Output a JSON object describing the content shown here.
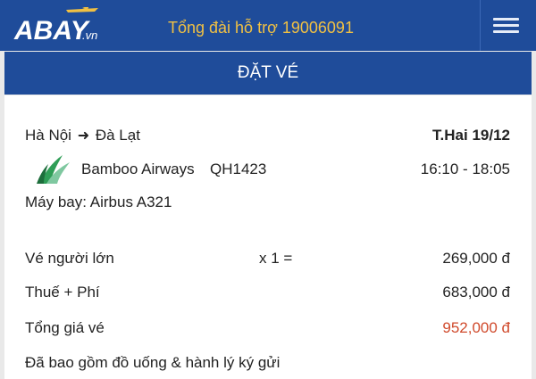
{
  "header": {
    "logo_text": "ABAY",
    "logo_suffix": ".vn",
    "hotline": "Tổng đài hỗ trợ 19006091",
    "menu_icon": "hamburger-icon"
  },
  "page": {
    "title": "ĐẶT VÉ"
  },
  "flight": {
    "origin": "Hà Nội",
    "destination": "Đà Lạt",
    "arrow_icon": "arrow-right-icon",
    "date": "T.Hai  19/12",
    "airline": "Bamboo Airways",
    "flight_no": "QH1423",
    "time": "16:10 - 18:05",
    "aircraft": "Máy bay: Airbus A321"
  },
  "fare": {
    "adult_label": "Vé người lớn",
    "adult_qty": "x 1 =",
    "adult_price": "269,000 đ",
    "tax_label": "Thuế + Phí",
    "tax_price": "683,000 đ",
    "total_label": "Tổng giá vé",
    "total_price": "952,000 đ",
    "note": "Đã bao gồm đồ uống & hành lý ký gửi"
  },
  "colors": {
    "header_bg": "#1f4c9a",
    "hotline": "#f0c043",
    "total_price": "#d04a2c"
  }
}
